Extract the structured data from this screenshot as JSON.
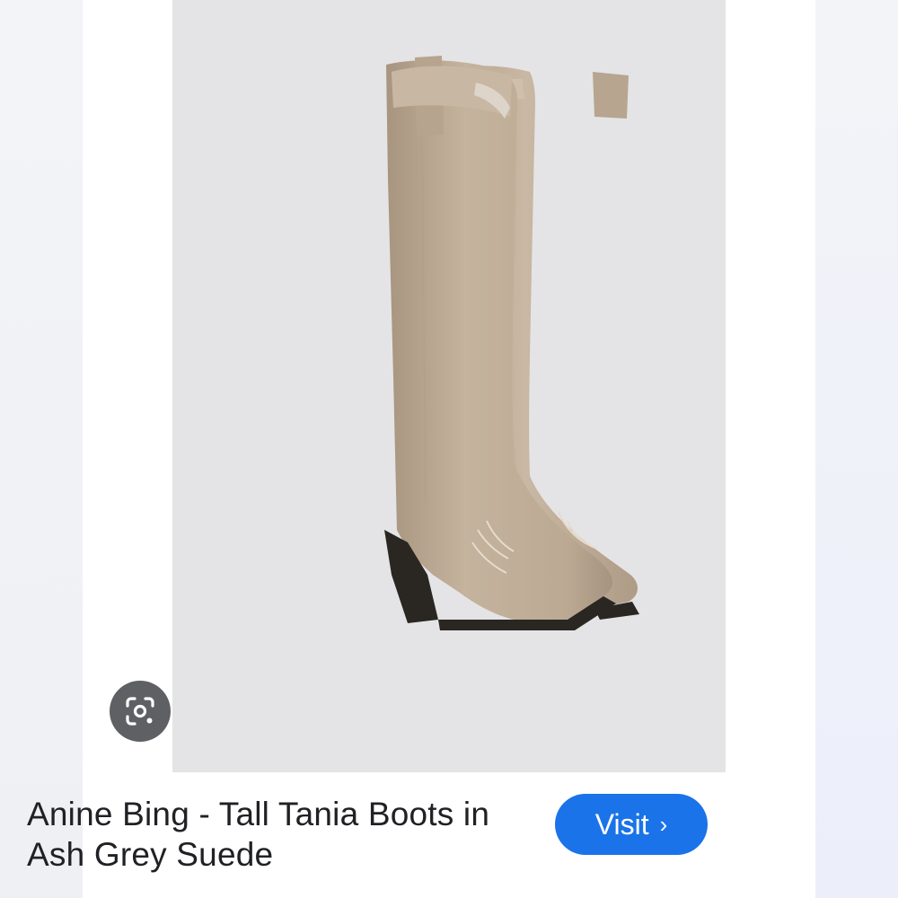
{
  "product": {
    "title": "Anine Bing - Tall Tania Boots in Ash Grey Suede",
    "image_alt": "Tall tan suede western boots"
  },
  "actions": {
    "visit_label": "Visit",
    "visit_chevron": "›",
    "lens_icon": "google-lens-icon"
  },
  "colors": {
    "accent": "#1a73e8",
    "suede": "#bfae98",
    "heel": "#2a2622",
    "backdrop": "#e4e4e6"
  }
}
